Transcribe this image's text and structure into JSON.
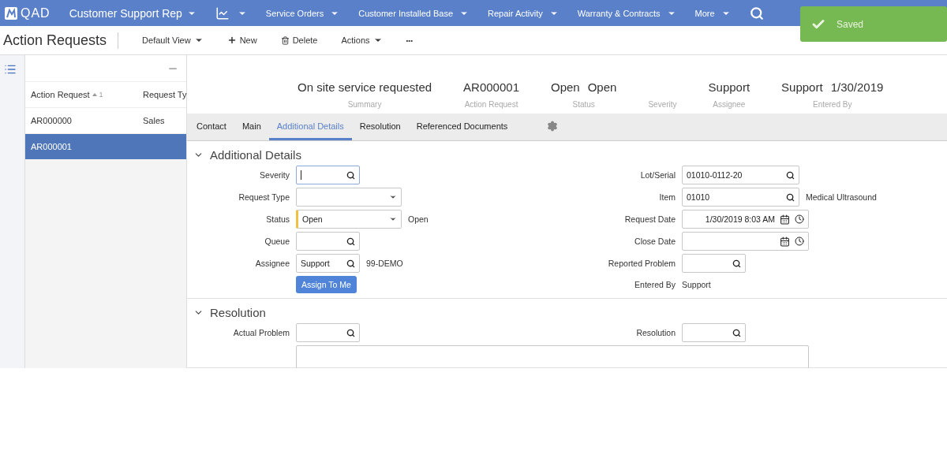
{
  "top_nav": {
    "logo": "QAD",
    "role": "Customer Support Rep",
    "menus": [
      {
        "label": "Service Orders"
      },
      {
        "label": "Customer Installed Base"
      },
      {
        "label": "Repair Activity"
      },
      {
        "label": "Warranty & Contracts"
      },
      {
        "label": "More"
      }
    ]
  },
  "toast": {
    "message": "Saved"
  },
  "toolbar": {
    "title": "Action Requests",
    "view": "Default View",
    "buttons": [
      {
        "kind": "new",
        "label": "New"
      },
      {
        "kind": "delete",
        "label": "Delete"
      },
      {
        "kind": "menu",
        "label": "Actions"
      },
      {
        "kind": "more",
        "label": "•••"
      }
    ]
  },
  "list": {
    "columns": [
      {
        "label": "Action Request",
        "sort": "1"
      },
      {
        "label": "Request Ty"
      }
    ],
    "rows": [
      {
        "cells": [
          "AR000000",
          "Sales"
        ],
        "selected": false
      },
      {
        "cells": [
          "AR000001"
        ],
        "selected": true
      }
    ]
  },
  "summary": [
    {
      "values": [
        "On site service requested"
      ],
      "label": "Summary"
    },
    {
      "values": [
        "AR000001"
      ],
      "label": "Action Request"
    },
    {
      "values": [
        "Open",
        "Open"
      ],
      "label": "Status"
    },
    {
      "label": "Severity"
    },
    {
      "values": [
        "Support"
      ],
      "label": "Assignee"
    },
    {
      "values": [
        "Support",
        "1/30/2019"
      ],
      "label": "Entered By"
    }
  ],
  "tabs": [
    {
      "label": "Contact",
      "selected": false
    },
    {
      "label": "Main",
      "selected": false
    },
    {
      "label": "Additional Details",
      "selected": true
    },
    {
      "label": "Resolution",
      "selected": false
    },
    {
      "label": "Referenced Documents",
      "selected": false
    }
  ],
  "sections": [
    {
      "title": "Additional Details",
      "expanded": true,
      "left": [
        {
          "kind": "lookup",
          "label": "Severity",
          "focused": true
        },
        {
          "kind": "select",
          "label": "Request Type"
        },
        {
          "kind": "select",
          "label": "Status",
          "value": "Open",
          "required": true,
          "note": "Open"
        },
        {
          "kind": "lookup",
          "label": "Queue"
        },
        {
          "kind": "lookup",
          "label": "Assignee",
          "value": "Support",
          "note": "99-DEMO"
        },
        {
          "kind": "button",
          "label": "Assign To Me"
        }
      ],
      "right": [
        {
          "kind": "lookup",
          "label": "Lot/Serial",
          "value": "01010-0112-20",
          "wide": true
        },
        {
          "kind": "lookup",
          "label": "Item",
          "value": "01010",
          "wide": true,
          "note": "Medical Ultrasound"
        },
        {
          "kind": "date",
          "label": "Request Date",
          "value": "1/30/2019 8:03 AM"
        },
        {
          "kind": "date",
          "label": "Close Date"
        },
        {
          "kind": "lookup",
          "label": "Reported Problem"
        },
        {
          "kind": "text",
          "label": "Entered By",
          "value": "Support"
        }
      ]
    },
    {
      "title": "Resolution",
      "expanded": true,
      "left": [
        {
          "kind": "lookup",
          "label": "Actual Problem"
        },
        {
          "kind": "textarea"
        }
      ],
      "right": [
        {
          "kind": "lookup",
          "label": "Resolution"
        }
      ]
    }
  ]
}
